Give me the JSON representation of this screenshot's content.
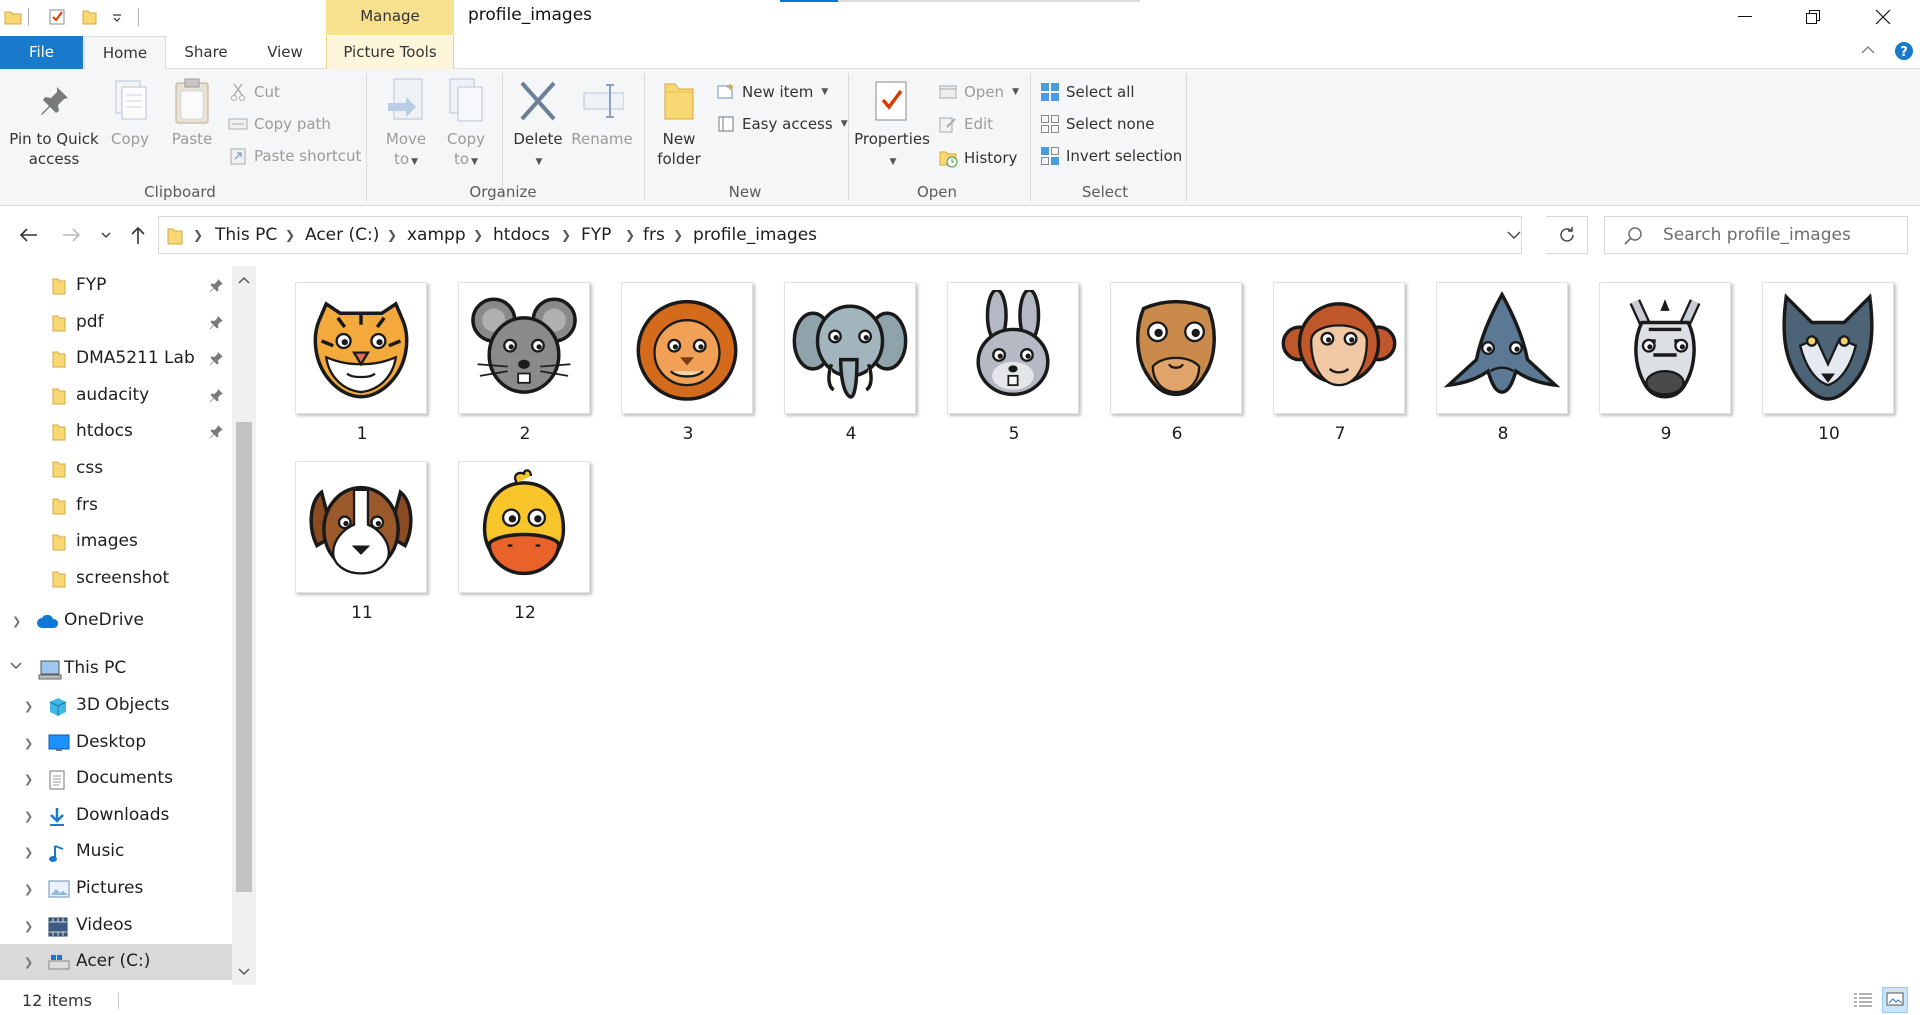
{
  "window": {
    "title": "profile_images",
    "contextual_tab_header": "Manage",
    "title_progress": 0.16
  },
  "tabs": {
    "file": "File",
    "home": "Home",
    "share": "Share",
    "view": "View",
    "picture_tools": "Picture Tools"
  },
  "ribbon": {
    "clipboard": {
      "label": "Clipboard",
      "pin": "Pin to Quick access",
      "pin_line1": "Pin to Quick",
      "pin_line2": "access",
      "copy": "Copy",
      "paste": "Paste",
      "cut": "Cut",
      "copy_path": "Copy path",
      "paste_shortcut": "Paste shortcut"
    },
    "organize": {
      "label": "Organize",
      "move_to_line1": "Move",
      "move_to_line2": "to",
      "copy_to_line1": "Copy",
      "copy_to_line2": "to",
      "delete": "Delete",
      "rename": "Rename"
    },
    "new": {
      "label": "New",
      "new_folder_line1": "New",
      "new_folder_line2": "folder",
      "new_item": "New item",
      "easy_access": "Easy access"
    },
    "open": {
      "label": "Open",
      "properties": "Properties",
      "open": "Open",
      "edit": "Edit",
      "history": "History"
    },
    "select": {
      "label": "Select",
      "select_all": "Select all",
      "select_none": "Select none",
      "invert_selection": "Invert selection"
    }
  },
  "address": {
    "crumbs": [
      "This PC",
      "Acer (C:)",
      "xampp",
      "htdocs",
      "FYP",
      "frs",
      "profile_images"
    ]
  },
  "search": {
    "placeholder": "Search profile_images"
  },
  "navpane": {
    "quick_access": [
      {
        "label": "FYP",
        "pinned": true
      },
      {
        "label": "pdf",
        "pinned": true
      },
      {
        "label": "DMA5211 Lab",
        "pinned": true
      },
      {
        "label": "audacity",
        "pinned": true
      },
      {
        "label": "htdocs",
        "pinned": true
      },
      {
        "label": "css",
        "pinned": false
      },
      {
        "label": "frs",
        "pinned": false
      },
      {
        "label": "images",
        "pinned": false
      },
      {
        "label": "screenshot",
        "pinned": false
      }
    ],
    "onedrive": "OneDrive",
    "this_pc": "This PC",
    "this_pc_children": [
      {
        "label": "3D Objects",
        "icon": "3d-objects-icon"
      },
      {
        "label": "Desktop",
        "icon": "desktop-icon"
      },
      {
        "label": "Documents",
        "icon": "documents-icon"
      },
      {
        "label": "Downloads",
        "icon": "downloads-icon"
      },
      {
        "label": "Music",
        "icon": "music-icon"
      },
      {
        "label": "Pictures",
        "icon": "pictures-icon"
      },
      {
        "label": "Videos",
        "icon": "videos-icon"
      },
      {
        "label": "Acer (C:)",
        "icon": "drive-icon"
      }
    ]
  },
  "files": [
    {
      "name": "1",
      "animal": "tiger"
    },
    {
      "name": "2",
      "animal": "mouse"
    },
    {
      "name": "3",
      "animal": "lion"
    },
    {
      "name": "4",
      "animal": "elephant"
    },
    {
      "name": "5",
      "animal": "rabbit"
    },
    {
      "name": "6",
      "animal": "camel"
    },
    {
      "name": "7",
      "animal": "monkey"
    },
    {
      "name": "8",
      "animal": "shark"
    },
    {
      "name": "9",
      "animal": "zebra"
    },
    {
      "name": "10",
      "animal": "wolf"
    },
    {
      "name": "11",
      "animal": "dog"
    },
    {
      "name": "12",
      "animal": "duck"
    }
  ],
  "status": {
    "item_count": "12 items"
  },
  "colors": {
    "file_tab": "#1979ca",
    "manage_tab": "#f7e08e",
    "folder": "#f8d775",
    "accent": "#0078d7"
  }
}
